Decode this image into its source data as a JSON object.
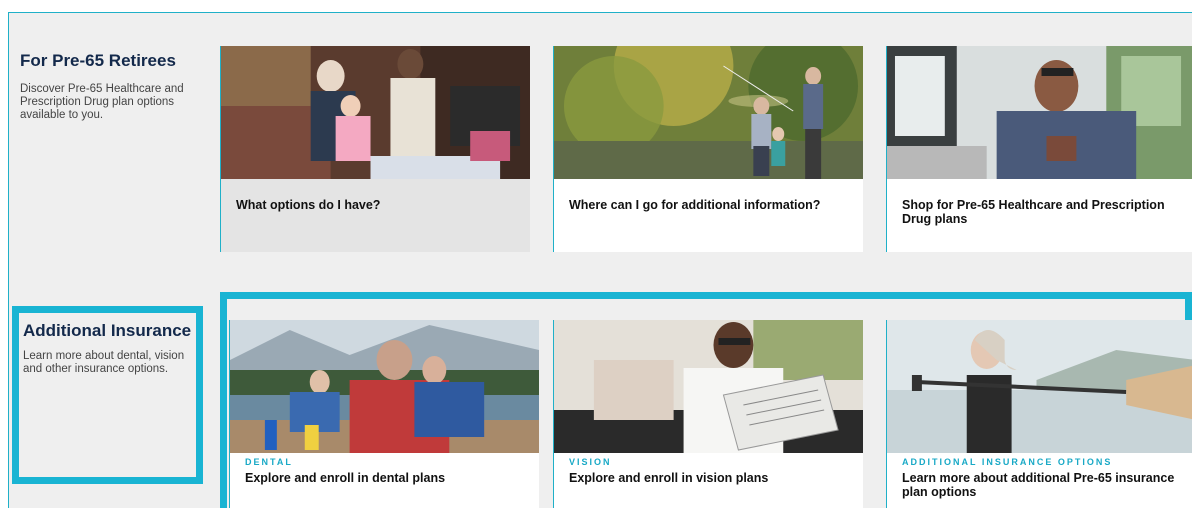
{
  "sections": {
    "retirees": {
      "title": "For Pre-65 Retirees",
      "description": "Discover Pre-65 Healthcare and Prescription Drug plan options available to you.",
      "cards": [
        {
          "label": "What options do I have?",
          "image": "family-living-room-photo"
        },
        {
          "label": "Where can I go for additional information?",
          "image": "grandparents-fishing-photo"
        },
        {
          "label": "Shop for Pre-65 Healthcare and Prescription Drug plans",
          "image": "man-office-window-photo"
        }
      ]
    },
    "additional": {
      "title": "Additional Insurance",
      "description": "Learn more about dental, vision and other insurance options.",
      "cards": [
        {
          "kicker": "DENTAL",
          "label": "Explore and enroll in dental plans",
          "image": "family-picnic-lake-photo"
        },
        {
          "kicker": "VISION",
          "label": "Explore and enroll in vision plans",
          "image": "man-reading-newspaper-photo"
        },
        {
          "kicker": "ADDITIONAL INSURANCE OPTIONS",
          "label": "Learn more about additional Pre-65 insurance plan options",
          "image": "woman-paddle-lake-photo"
        }
      ]
    }
  },
  "colors": {
    "accent": "#19b4d3",
    "title": "#13294b",
    "panel": "#efefef"
  }
}
